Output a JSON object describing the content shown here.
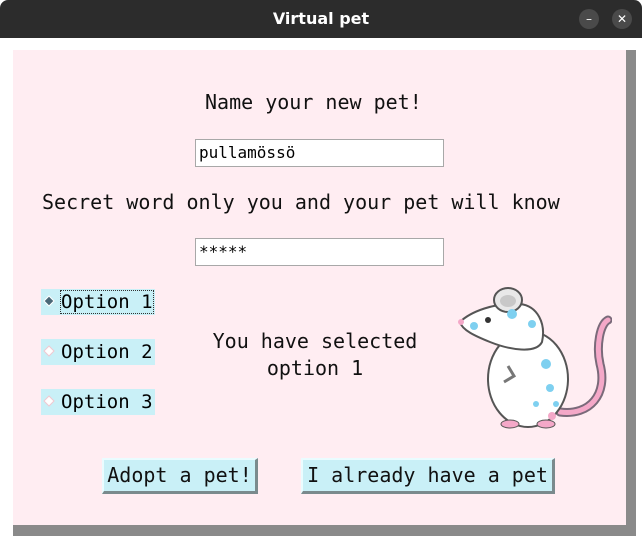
{
  "window": {
    "title": "Virtual pet",
    "minimize_glyph": "–",
    "close_glyph": "✕"
  },
  "form": {
    "name_label": "Name your new pet!",
    "name_value": "pullamössö",
    "secret_label": "Secret word only you and your pet will know",
    "secret_value": "*****"
  },
  "options": [
    {
      "label": "Option 1",
      "selected": true
    },
    {
      "label": "Option 2",
      "selected": false
    },
    {
      "label": "Option 3",
      "selected": false
    }
  ],
  "status": {
    "line1": "You have selected",
    "line2": "option 1"
  },
  "buttons": {
    "adopt": "Adopt a pet!",
    "existing": "I already have a pet"
  },
  "icons": {
    "pet_image": "white-rat-icon"
  },
  "colors": {
    "background": "#ffedf2",
    "button": "#c9f0f7",
    "titlebar": "#2c2c2c"
  }
}
